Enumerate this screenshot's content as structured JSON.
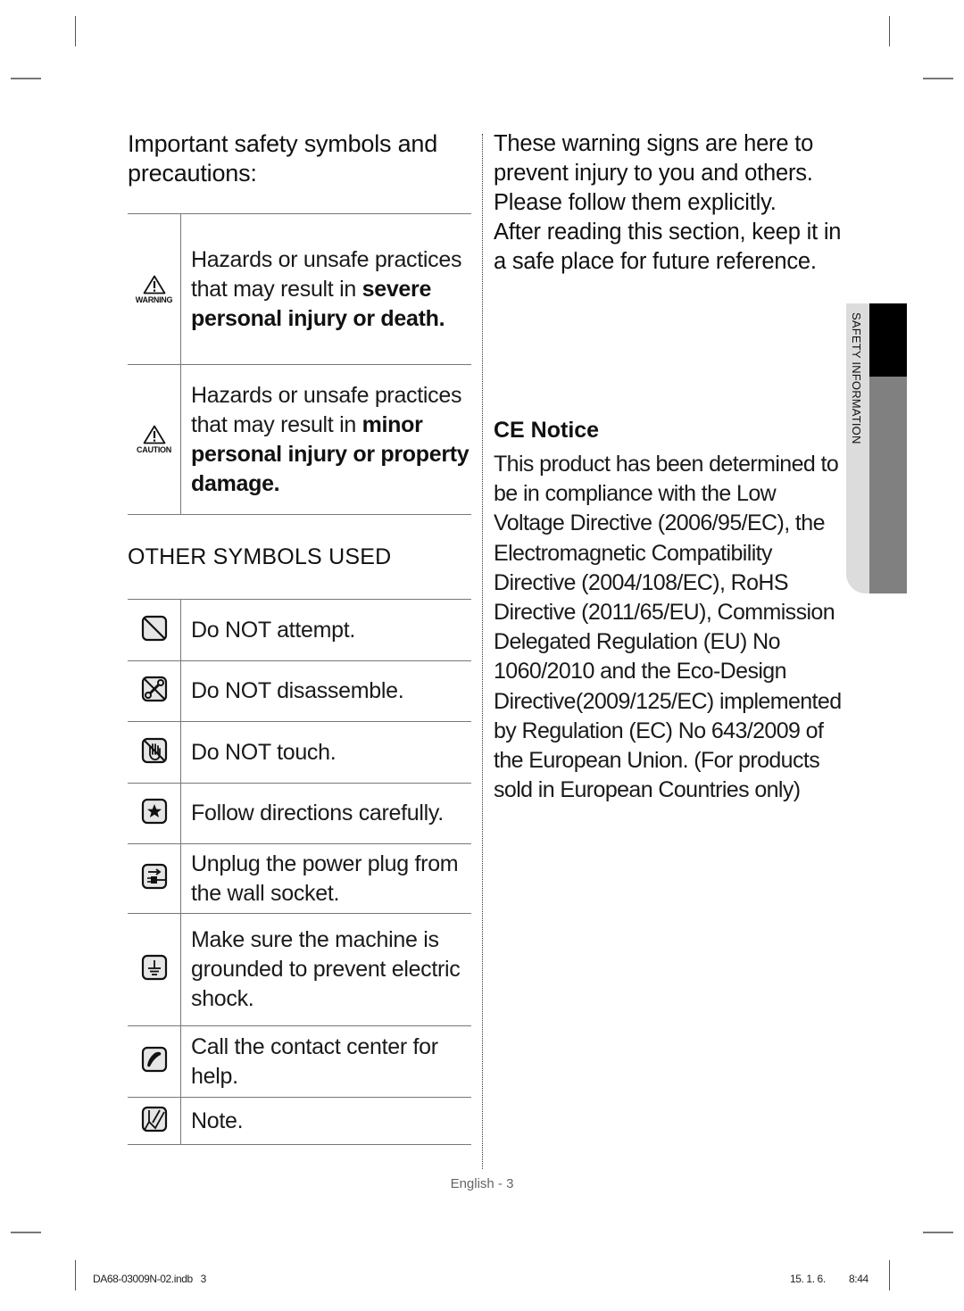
{
  "left": {
    "heading": "Important safety symbols and precautions:",
    "precautions": [
      {
        "icon": "warning-triangle-icon",
        "icon_label": "WARNING",
        "text_plain": "Hazards or unsafe practices that may result in ",
        "text_bold": "severe personal injury or death."
      },
      {
        "icon": "caution-triangle-icon",
        "icon_label": "CAUTION",
        "text_plain": "Hazards or unsafe practices that may result in ",
        "text_bold": "minor personal injury or property damage."
      }
    ],
    "other_heading": "OTHER SYMBOLS USED",
    "other_symbols": [
      {
        "icon": "prohibition-icon",
        "text": "Do NOT attempt."
      },
      {
        "icon": "no-disassemble-icon",
        "text": "Do NOT disassemble."
      },
      {
        "icon": "no-touch-icon",
        "text": "Do NOT touch."
      },
      {
        "icon": "star-icon",
        "text": "Follow directions carefully."
      },
      {
        "icon": "unplug-icon",
        "text": "Unplug the power plug from the wall socket."
      },
      {
        "icon": "ground-icon",
        "text": "Make sure the machine is grounded to prevent electric shock."
      },
      {
        "icon": "phone-icon",
        "text": "Call the contact center for help."
      },
      {
        "icon": "note-icon",
        "text": "Note."
      }
    ]
  },
  "right": {
    "intro": "These warning signs are here to prevent injury to you and others.\nPlease follow them explicitly.\nAfter reading this section, keep it in a safe place for future reference.",
    "ce_title": "CE Notice",
    "ce_body": "This product has been determined to be in compliance with the Low Voltage Directive (2006/95/EC), the Electromagnetic Compatibility Directive (2004/108/EC), RoHS Directive (2011/65/EU), Commission Delegated Regulation (EU) No 1060/2010 and the Eco-Design Directive(2009/125/EC) implemented by Regulation (EC) No 643/2009 of the European Union. (For products sold in European Countries only)"
  },
  "side_tab": {
    "label": "SAFETY INFORMATION",
    "colors": {
      "light": "#dcdcdc",
      "active": "#000000",
      "inactive": "#808080"
    }
  },
  "page_number": "English - 3",
  "footer": {
    "file": "DA68-03009N-02.indb   3",
    "date": "15. 1. 6.",
    "time": "8:44"
  }
}
